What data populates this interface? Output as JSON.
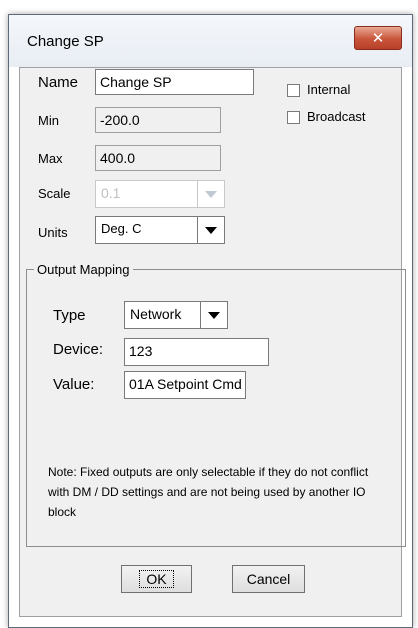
{
  "dialog": {
    "title": "Change SP",
    "close_glyph": "✕"
  },
  "name": {
    "label": "Name",
    "value": "Change SP"
  },
  "min": {
    "label": "Min",
    "value": "-200.0"
  },
  "max": {
    "label": "Max",
    "value": "400.0"
  },
  "scale": {
    "label": "Scale",
    "value": "0.1"
  },
  "units": {
    "label": "Units",
    "value": "Deg. C"
  },
  "internal": {
    "label": "Internal",
    "checked": false
  },
  "broadcast": {
    "label": "Broadcast",
    "checked": false
  },
  "output_mapping": {
    "legend": "Output Mapping",
    "type": {
      "label": "Type",
      "value": "Network"
    },
    "device": {
      "label": "Device:",
      "value": "123"
    },
    "value": {
      "label": "Value:",
      "value": "01A Setpoint Cmd"
    },
    "note": "Note: Fixed outputs are only selectable if they do not conflict with DM / DD settings and are not being used by another IO block"
  },
  "buttons": {
    "ok": "OK",
    "cancel": "Cancel"
  }
}
